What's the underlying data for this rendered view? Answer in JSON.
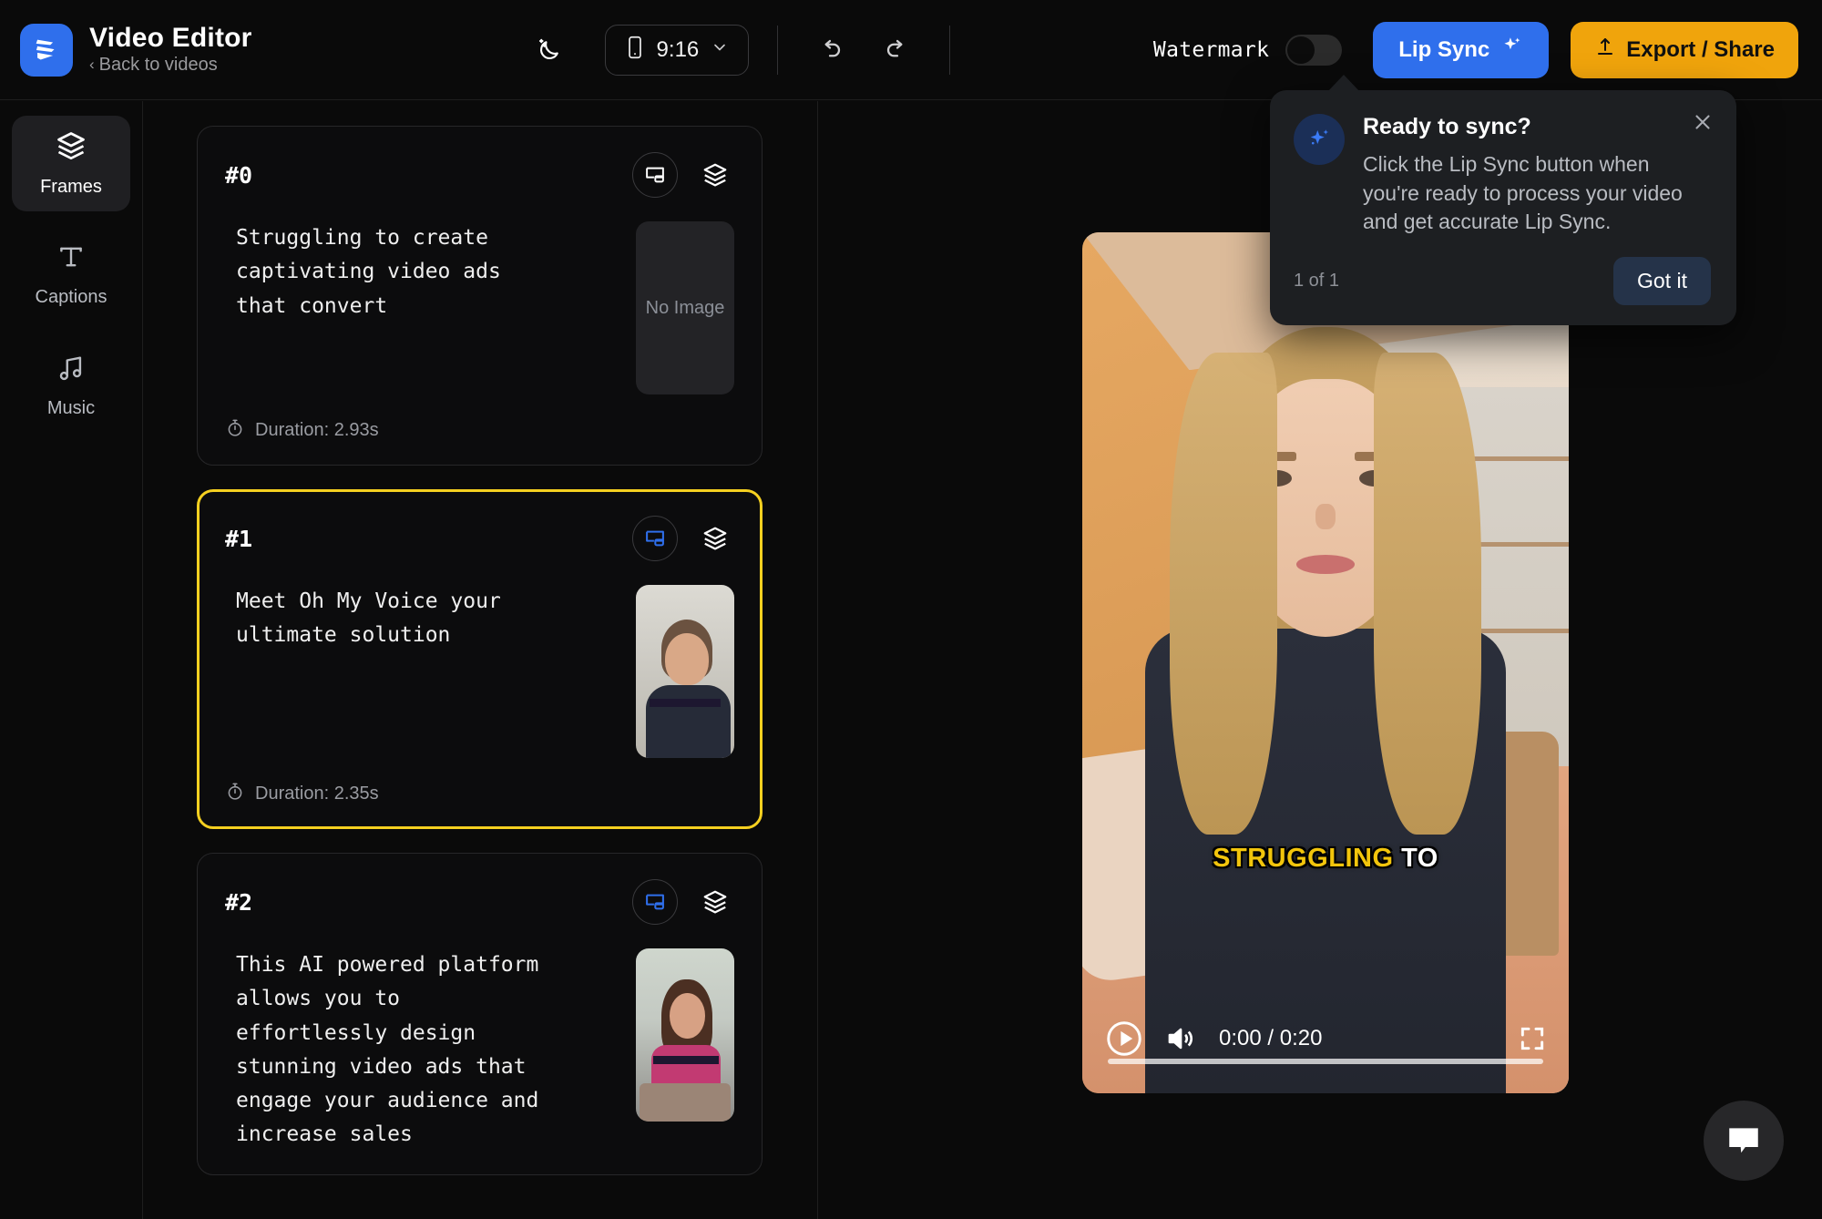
{
  "header": {
    "app_title": "Video Editor",
    "back_label": "Back to videos",
    "logo_icon": "video-editor-logo-icon",
    "theme_icon": "moon-stars-icon",
    "aspect_ratio": {
      "icon": "phone-icon",
      "value": "9:16",
      "chevron_icon": "chevron-down-icon"
    },
    "undo_icon": "undo-icon",
    "redo_icon": "redo-icon",
    "watermark": {
      "label": "Watermark",
      "enabled": false
    },
    "lip_sync_button": {
      "label": "Lip Sync",
      "icon": "sparkle-icon",
      "color": "#2f6fec"
    },
    "export_button": {
      "label": "Export / Share",
      "icon": "upload-icon",
      "color": "#f0a40c"
    }
  },
  "sidebar": {
    "items": [
      {
        "label": "Frames",
        "icon": "layers-icon",
        "active": true
      },
      {
        "label": "Captions",
        "icon": "text-t-icon",
        "active": false
      },
      {
        "label": "Music",
        "icon": "music-note-icon",
        "active": false
      }
    ]
  },
  "frames": [
    {
      "number": "#0",
      "text": "Struggling to create\ncaptivating video ads\nthat convert",
      "duration": "Duration: 2.93s",
      "duration_icon": "stopwatch-icon",
      "pip_icon": "picture-in-picture-icon",
      "pip_active": false,
      "layers_icon": "layers-icon",
      "thumbnail": "No Image",
      "selected": false
    },
    {
      "number": "#1",
      "text": "Meet Oh My Voice your\nultimate solution",
      "duration": "Duration: 2.35s",
      "duration_icon": "stopwatch-icon",
      "pip_icon": "picture-in-picture-icon",
      "pip_active": true,
      "layers_icon": "layers-icon",
      "thumbnail": "",
      "selected": true
    },
    {
      "number": "#2",
      "text": "This AI powered platform\nallows you to\neffortlessly design\nstunning video ads that\nengage your audience and\nincrease sales",
      "duration": "",
      "duration_icon": "stopwatch-icon",
      "pip_icon": "picture-in-picture-icon",
      "pip_active": true,
      "layers_icon": "layers-icon",
      "thumbnail": "",
      "selected": false
    }
  ],
  "player": {
    "caption_highlight": "STRUGGLING",
    "caption_plain": "TO",
    "play_icon": "play-icon",
    "volume_icon": "volume-on-icon",
    "time": "0:00 / 0:20",
    "fullscreen_icon": "fullscreen-icon",
    "progress_percent": 0
  },
  "popover": {
    "badge_icon": "sparkle-icon",
    "title": "Ready to sync?",
    "body": "Click the Lip Sync button when you're ready to process your video and get accurate Lip Sync.",
    "counter": "1 of 1",
    "primary_label": "Got it",
    "close_icon": "close-icon"
  },
  "chat_fab": {
    "icon": "chat-bubble-icon"
  },
  "colors": {
    "accent_blue": "#2f6fec",
    "accent_yellow": "#f0a40c",
    "selected_border": "#f5d020",
    "caption_yellow": "#f2c50c",
    "background": "#0a0a0a"
  }
}
